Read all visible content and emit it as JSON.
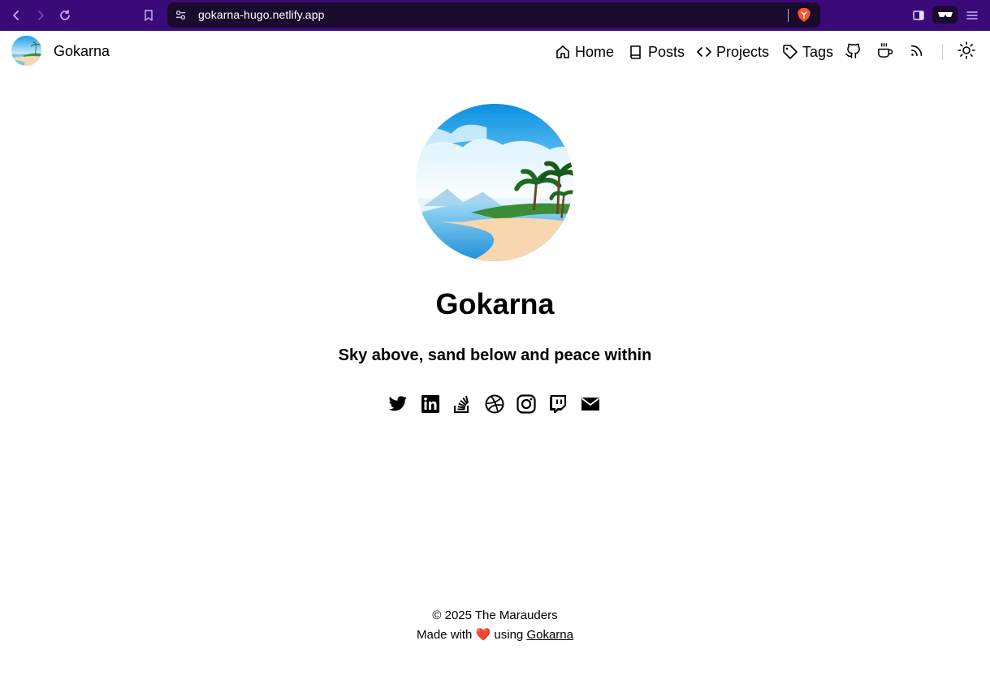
{
  "browser": {
    "url": "gokarna-hugo.netlify.app",
    "chrome_color": "#3a0a78"
  },
  "header": {
    "site_name": "Gokarna",
    "nav": [
      {
        "label": "Home",
        "icon": "home-icon"
      },
      {
        "label": "Posts",
        "icon": "book-icon"
      },
      {
        "label": "Projects",
        "icon": "code-icon"
      },
      {
        "label": "Tags",
        "icon": "tag-icon"
      }
    ],
    "nav_icons": [
      "github-icon",
      "coffee-icon",
      "rss-icon",
      "sun-icon"
    ]
  },
  "hero": {
    "title": "Gokarna",
    "tagline": "Sky above, sand below and peace within",
    "socials": [
      "twitter-icon",
      "linkedin-icon",
      "stackoverflow-icon",
      "dribbble-icon",
      "instagram-icon",
      "twitch-icon",
      "email-icon"
    ]
  },
  "footer": {
    "copyright": "© 2025 The Marauders",
    "made_with": "Made with",
    "heart": "❤️",
    "using": "using",
    "link_text": "Gokarna"
  }
}
